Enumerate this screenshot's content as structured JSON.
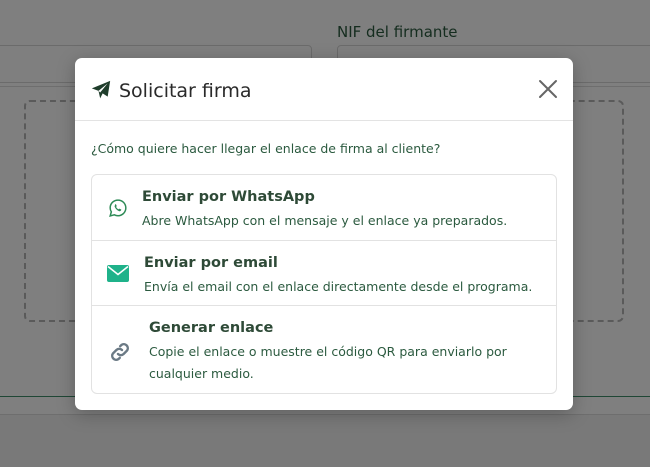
{
  "background": {
    "nif_label": "NIF del firmante"
  },
  "modal": {
    "title": "Solicitar firma",
    "prompt": "¿Cómo quiere hacer llegar el enlace de firma al cliente?",
    "options": [
      {
        "title": "Enviar por WhatsApp",
        "description": "Abre WhatsApp con el mensaje y el enlace ya preparados.",
        "icon": "whatsapp-icon"
      },
      {
        "title": "Enviar por email",
        "description": "Envía el email con el enlace directamente desde el programa.",
        "icon": "envelope-icon"
      },
      {
        "title": "Generar enlace",
        "description": "Copie el enlace o muestre el código QR para enviarlo por cualquier medio.",
        "icon": "link-icon"
      }
    ]
  },
  "colors": {
    "accent_green": "#2b5a3f",
    "whatsapp_green": "#2e8b57",
    "email_teal": "#1fb28a",
    "link_gray": "#6b7a85"
  }
}
